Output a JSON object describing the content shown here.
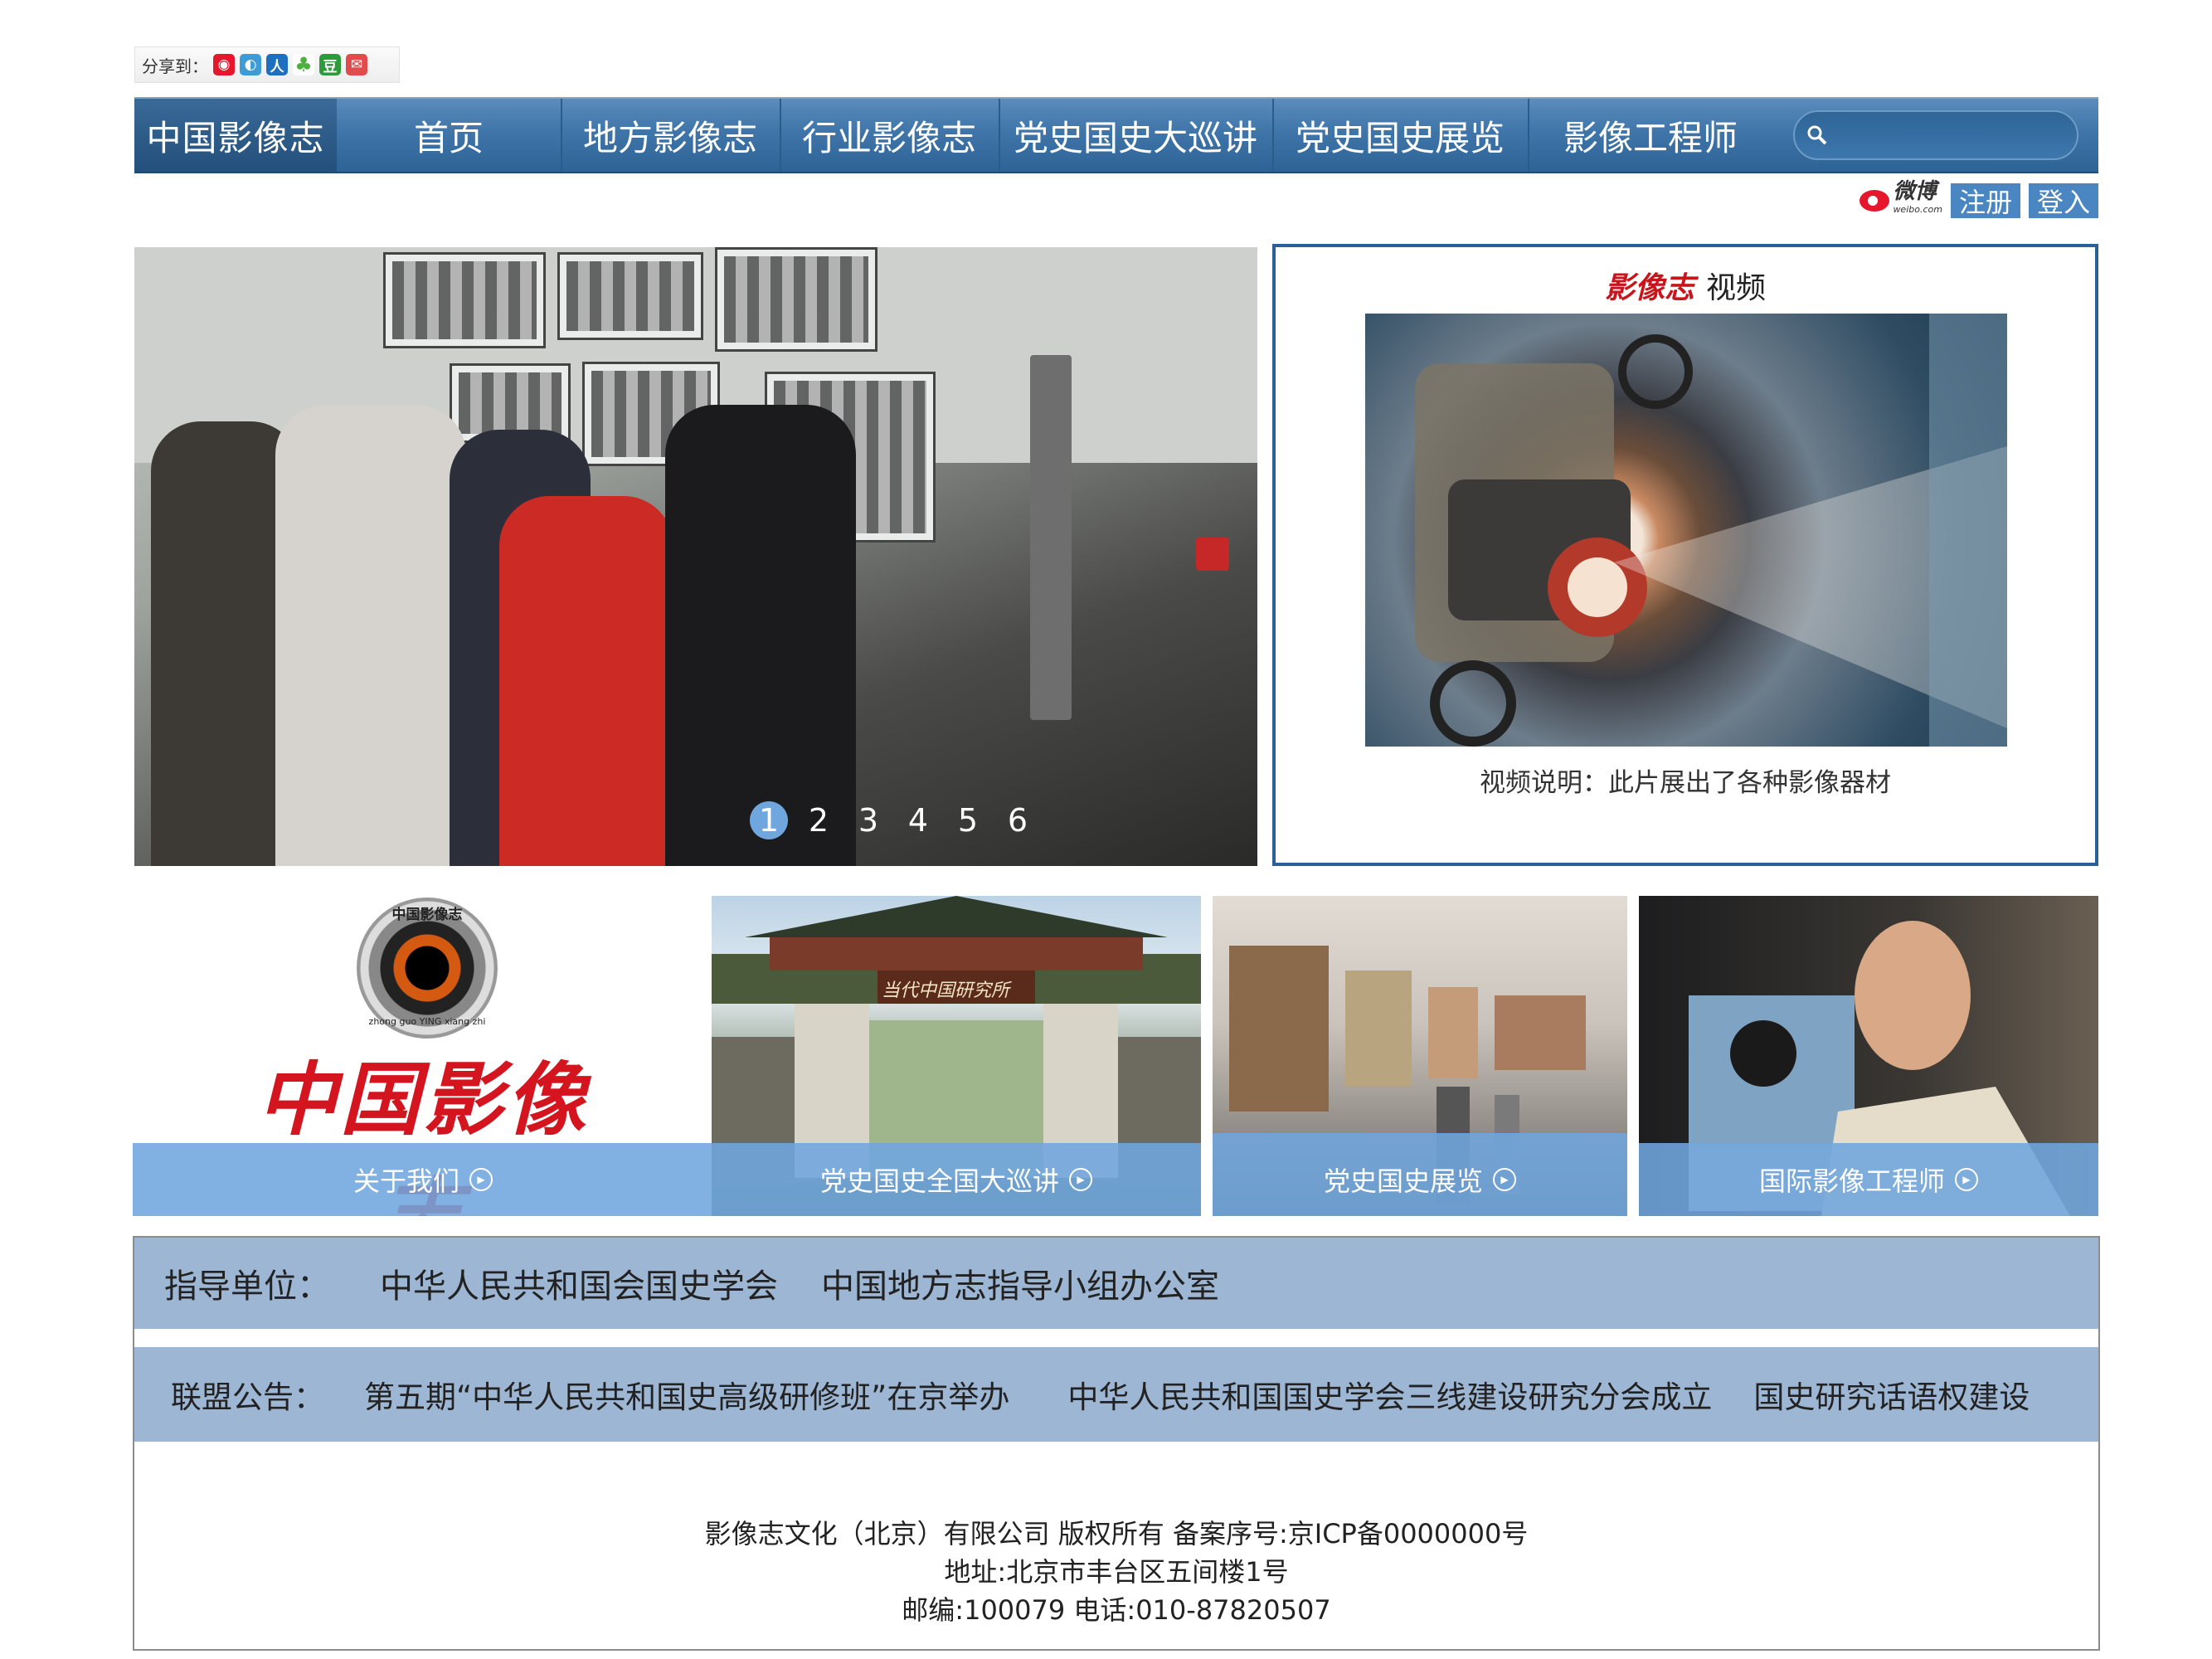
{
  "share": {
    "label": "分享到：",
    "icons": [
      "sina-icon",
      "qzone-icon",
      "renren-icon",
      "kaixin-icon",
      "douban-icon",
      "tqq-icon"
    ],
    "douban_text": "豆"
  },
  "nav": {
    "brand": "中国影像志",
    "items": [
      "首页",
      "地方影像志",
      "行业影像志",
      "党史国史大巡讲",
      "党史国史展览",
      "影像工程师"
    ],
    "search_placeholder": ""
  },
  "auth": {
    "weibo": "微博",
    "weibo_domain": "weibo.com",
    "register": "注册",
    "login": "登入"
  },
  "slider": {
    "pages": [
      "1",
      "2",
      "3",
      "4",
      "5",
      "6"
    ],
    "active": "1"
  },
  "video": {
    "brand": "影像志",
    "title": "视频",
    "caption": "视频说明：此片展出了各种影像器材"
  },
  "tiles": [
    {
      "caption": "关于我们",
      "logo_ring_text": "中国影像志",
      "logo_ring_side": "zhong guo YING xiang zhi",
      "logo_title": "中国影像志"
    },
    {
      "caption": "党史国史全国大巡讲",
      "gate_sign": "当代中国研究所"
    },
    {
      "caption": "党史国史展览"
    },
    {
      "caption": "国际影像工程师"
    }
  ],
  "guidance": {
    "label": "指导单位：",
    "units": [
      "中华人民共和国会国史学会",
      "中国地方志指导小组办公室"
    ]
  },
  "notice": {
    "label": "联盟公告：",
    "items": [
      "第五期“中华人民共和国史高级研修班”在京举办",
      "中华人民共和国国史学会三线建设研究分会成立",
      "国史研究话语权建设"
    ]
  },
  "footer": {
    "line1": "影像志文化（北京）有限公司  版权所有  备案序号:京ICP备0000000号",
    "line2": "地址:北京市丰台区五间楼1号",
    "line3": "邮编:100079  电话:010-87820507"
  },
  "colors": {
    "nav": "#3f75a9",
    "accent": "#6fa6de",
    "bar": "#9db6d3",
    "border": "#2b5f97",
    "brand_red": "#d4141e"
  }
}
